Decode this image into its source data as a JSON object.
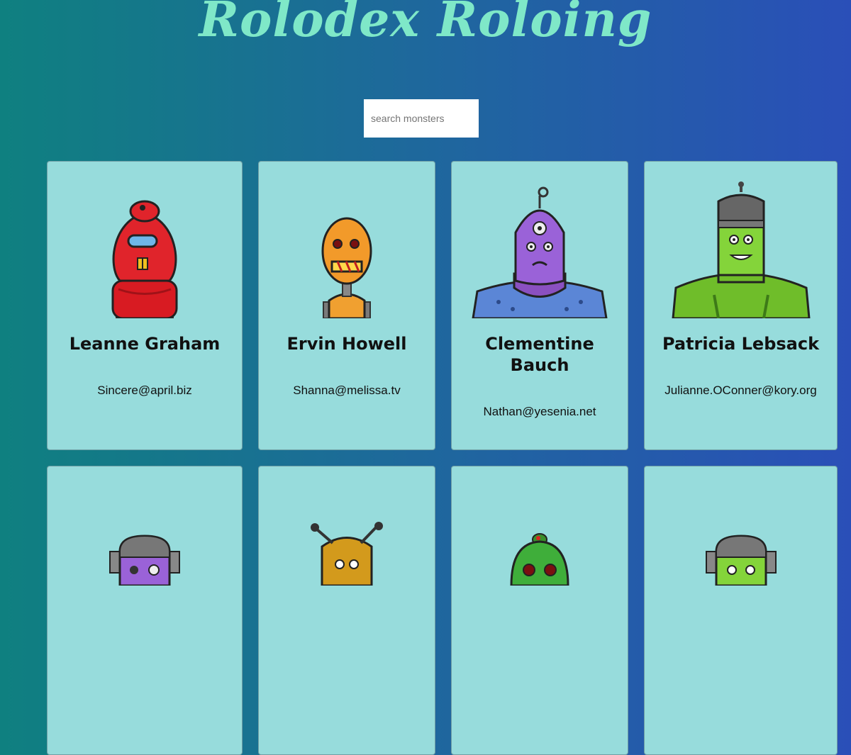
{
  "app": {
    "title": "Rolodex Roloing"
  },
  "search": {
    "placeholder": "search monsters"
  },
  "monsters": [
    {
      "name": "Leanne Graham",
      "email": "Sincere@april.biz",
      "icon": "red-robot-monster-icon"
    },
    {
      "name": "Ervin Howell",
      "email": "Shanna@melissa.tv",
      "icon": "orange-robot-monster-icon"
    },
    {
      "name": "Clementine Bauch",
      "email": "Nathan@yesenia.net",
      "icon": "purple-cyclops-monster-icon"
    },
    {
      "name": "Patricia Lebsack",
      "email": "Julianne.OConner@kory.org",
      "icon": "green-frankenstein-monster-icon"
    },
    {
      "name": "",
      "email": "",
      "icon": "purple-robot-monster-icon"
    },
    {
      "name": "",
      "email": "",
      "icon": "gold-antenna-monster-icon"
    },
    {
      "name": "",
      "email": "",
      "icon": "green-alien-monster-icon"
    },
    {
      "name": "",
      "email": "",
      "icon": "lime-robot-monster-icon"
    }
  ]
}
